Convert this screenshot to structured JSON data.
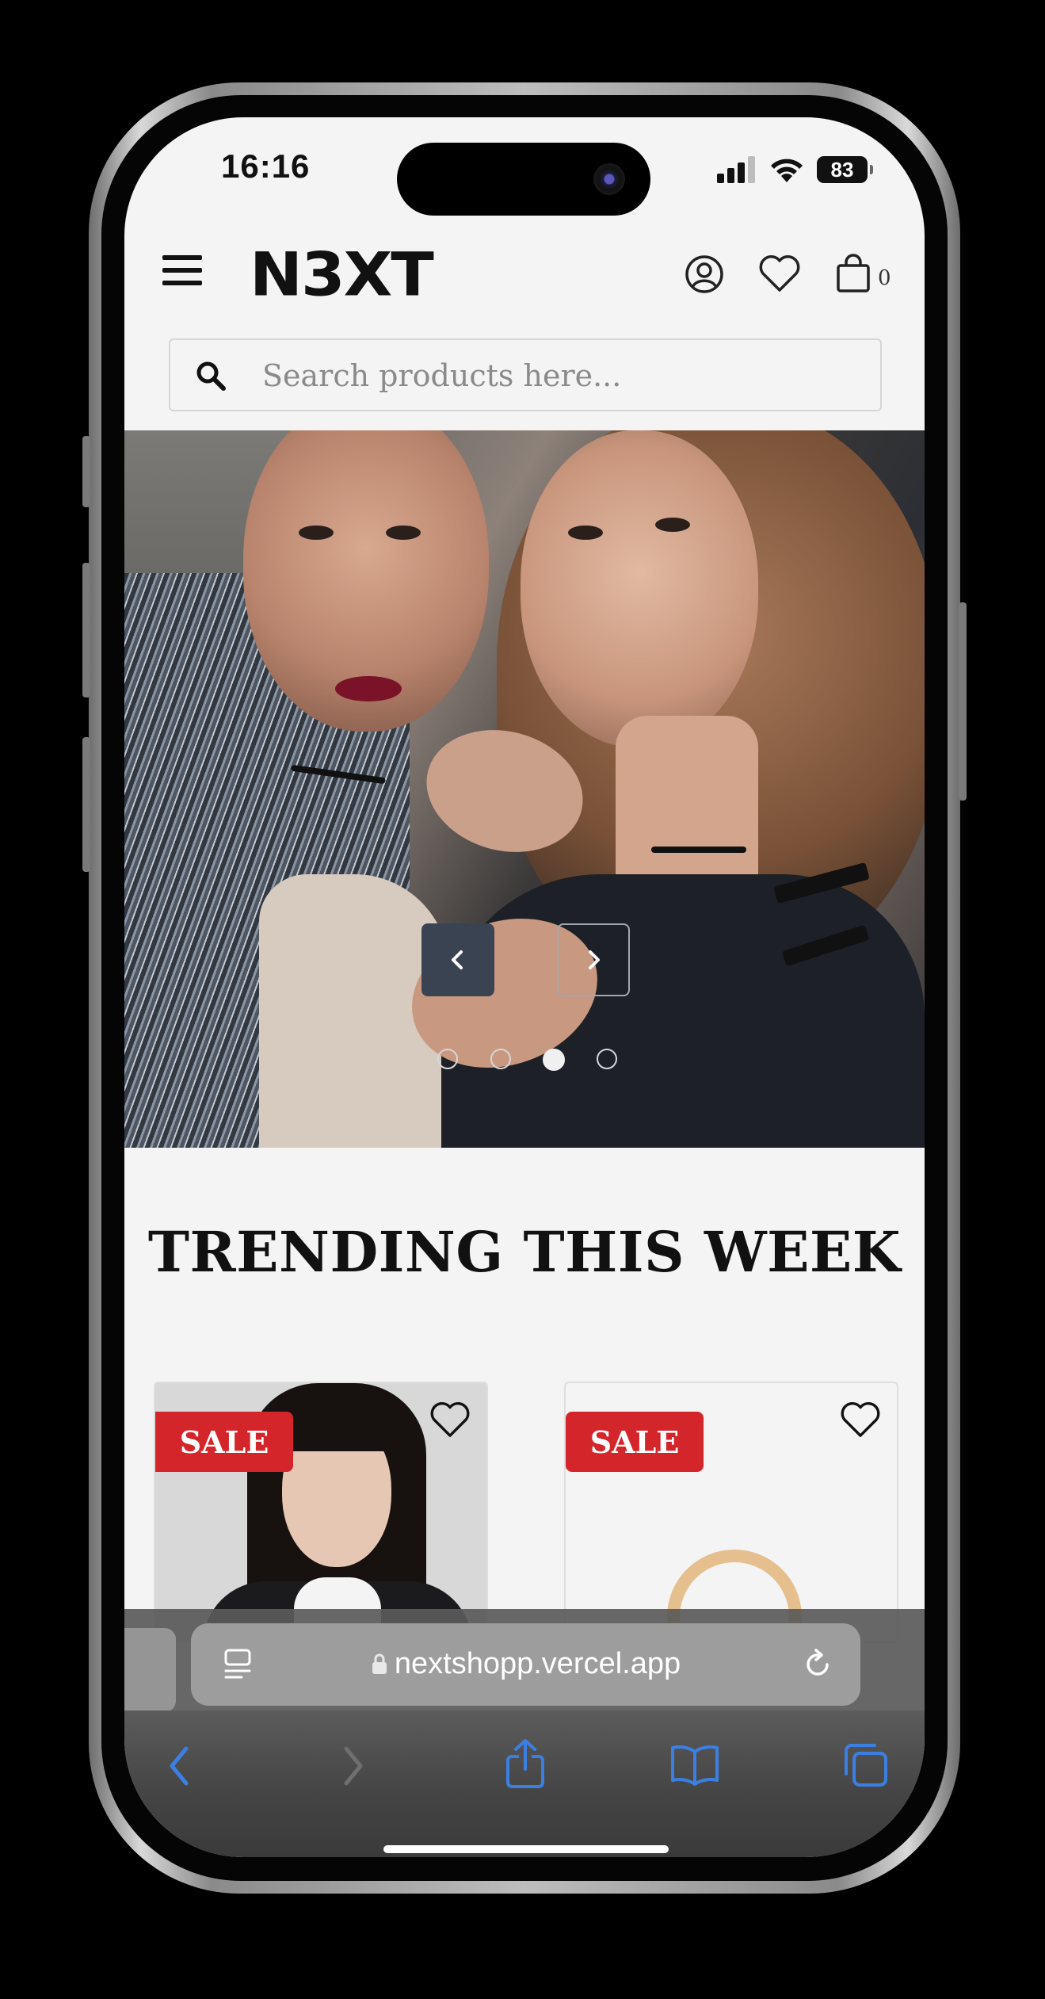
{
  "status_bar": {
    "time": "16:16",
    "battery": "83"
  },
  "header": {
    "logo": "N3XT",
    "cart_count": "0",
    "icons": [
      "menu-icon",
      "user-icon",
      "heart-icon",
      "bag-icon"
    ]
  },
  "search": {
    "placeholder": "Search products here..."
  },
  "hero": {
    "slides_total": 4,
    "active_slide": 3
  },
  "trending": {
    "title": "TRENDING THIS WEEK",
    "products": [
      {
        "badge": "SALE"
      },
      {
        "badge": "SALE"
      }
    ]
  },
  "browser": {
    "url": "nextshopp.vercel.app"
  },
  "colors": {
    "sale_red": "#d4252b",
    "accent_blue": "#3c7fe3",
    "slider_button": "#3a4352"
  }
}
